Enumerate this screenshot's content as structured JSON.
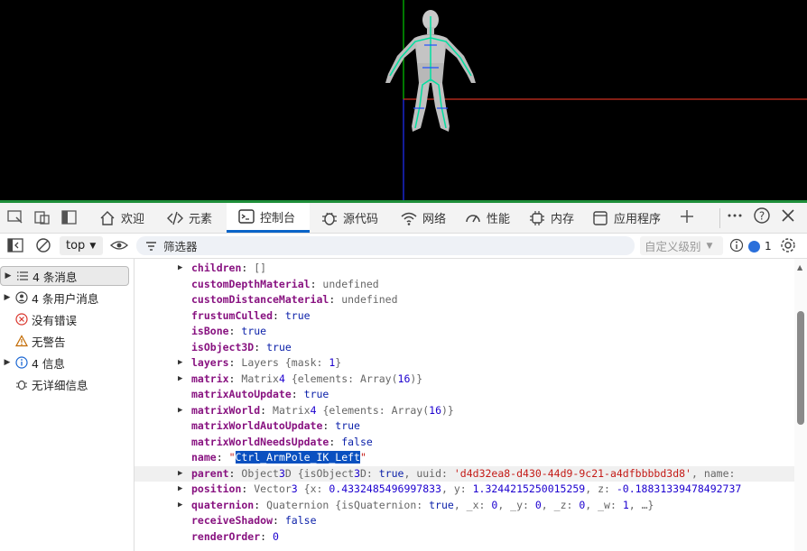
{
  "tabs": [
    {
      "label": "欢迎",
      "icon": "home-icon"
    },
    {
      "label": "元素",
      "icon": "code-icon"
    },
    {
      "label": "控制台",
      "icon": "console-icon",
      "active": true
    },
    {
      "label": "源代码",
      "icon": "bug-icon"
    },
    {
      "label": "网络",
      "icon": "wifi-icon"
    },
    {
      "label": "性能",
      "icon": "gauge-icon"
    },
    {
      "label": "内存",
      "icon": "chip-icon"
    },
    {
      "label": "应用程序",
      "icon": "app-icon"
    }
  ],
  "toolbar": {
    "context": "top",
    "filter_placeholder": "筛选器",
    "levels": "自定义级别",
    "issues_count": "1"
  },
  "sidebar": [
    {
      "label": "4 条消息",
      "icon": "list-icon",
      "arrow": true,
      "selected": true
    },
    {
      "label": "4 条用户消息",
      "icon": "user-icon",
      "arrow": true
    },
    {
      "label": "没有错误",
      "icon": "error-icon"
    },
    {
      "label": "无警告",
      "icon": "warning-icon"
    },
    {
      "label": "4 信息",
      "icon": "info-icon",
      "arrow": true
    },
    {
      "label": "无详细信息",
      "icon": "verbose-icon"
    }
  ],
  "console": {
    "lines": [
      {
        "key": "children",
        "val": "[]",
        "expand": true
      },
      {
        "key": "customDepthMaterial",
        "val": "undefined"
      },
      {
        "key": "customDistanceMaterial",
        "val": "undefined"
      },
      {
        "key": "frustumCulled",
        "val": "true"
      },
      {
        "key": "isBone",
        "val": "true"
      },
      {
        "key": "isObject3D",
        "val": "true"
      },
      {
        "key": "layers",
        "val": "Layers {mask: 1}",
        "expand": true
      },
      {
        "key": "matrix",
        "val": "Matrix4 {elements: Array(16)}",
        "expand": true
      },
      {
        "key": "matrixAutoUpdate",
        "val": "true"
      },
      {
        "key": "matrixWorld",
        "val": "Matrix4 {elements: Array(16)}",
        "expand": true
      },
      {
        "key": "matrixWorldAutoUpdate",
        "val": "true"
      },
      {
        "key": "matrixWorldNeedsUpdate",
        "val": "false"
      },
      {
        "key": "name",
        "val": "\"Ctrl_ArmPole_IK_Left\""
      },
      {
        "key": "parent",
        "val": "Object3D {isObject3D: true, uuid: 'd4d32ea8-d430-44d9-9c21-a4dfbbbbd3d8', name:",
        "expand": true
      },
      {
        "key": "position",
        "val": "Vector3 {x: 0.4332485496997833, y: 1.3244215250015259, z: -0.18831339478492737",
        "expand": true
      },
      {
        "key": "quaternion",
        "val": "Quaternion {isQuaternion: true, _x: 0, _y: 0, _z: 0, _w: 1, …}",
        "expand": true
      },
      {
        "key": "receiveShadow",
        "val": "false"
      },
      {
        "key": "renderOrder",
        "val": "0"
      }
    ]
  }
}
